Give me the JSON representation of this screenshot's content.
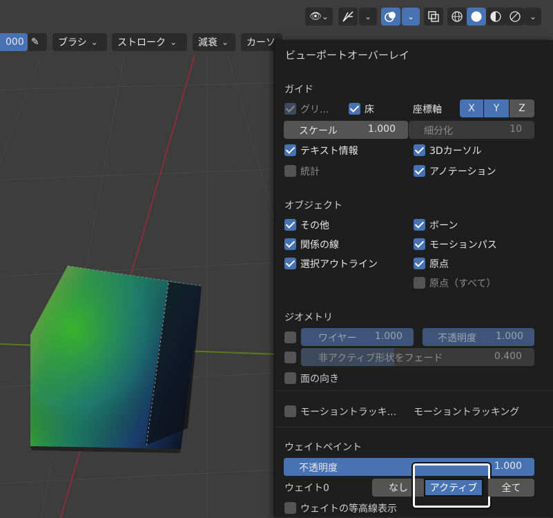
{
  "header": {
    "field_value": "000",
    "brush_label": "ブラシ",
    "stroke_label": "ストローク",
    "falloff_label": "減衰",
    "cursor_label": "カーソ"
  },
  "overlay": {
    "title": "ビューポートオーバーレイ",
    "guides": {
      "section": "ガイド",
      "grid_label": "グリ...",
      "floor_label": "床",
      "axes_label": "座標軸",
      "axis_x": "X",
      "axis_y": "Y",
      "axis_z": "Z",
      "scale_label": "スケール",
      "scale_value": "1.000",
      "subdiv_label": "細分化",
      "subdiv_value": "10",
      "text_info_label": "テキスト情報",
      "cursor3d_label": "3Dカーソル",
      "stats_label": "統計",
      "annotation_label": "アノテーション"
    },
    "objects": {
      "section": "オブジェクト",
      "extras_label": "その他",
      "bones_label": "ボーン",
      "relations_label": "関係の線",
      "motion_paths_label": "モーションパス",
      "outline_label": "選択アウトライン",
      "origins_label": "原点",
      "origins_all_label": "原点（すべて）"
    },
    "geometry": {
      "section": "ジオメトリ",
      "wireframe_label": "ワイヤー",
      "wireframe_value": "1.000",
      "opacity_label": "不透明度",
      "opacity_value": "1.000",
      "fade_label": "非アクティブ形状をフェード",
      "fade_value": "0.400",
      "face_orient_label": "面の向き"
    },
    "motion": {
      "tracking_label": "モーショントラッキ...",
      "tracking_label2": "モーショントラッキング"
    },
    "weight_paint": {
      "section": "ウェイトペイント",
      "opacity_label": "不透明度",
      "opacity_value": "1.000",
      "zero_weight_label": "ウェイト0",
      "opt_none": "なし",
      "opt_active": "アクティブ",
      "opt_all": "全て",
      "contours_label": "ウェイトの等高線表示"
    }
  },
  "colors": {
    "accent": "#4772b3",
    "panel_bg": "#1e1e1e",
    "field_bg": "#545454"
  }
}
